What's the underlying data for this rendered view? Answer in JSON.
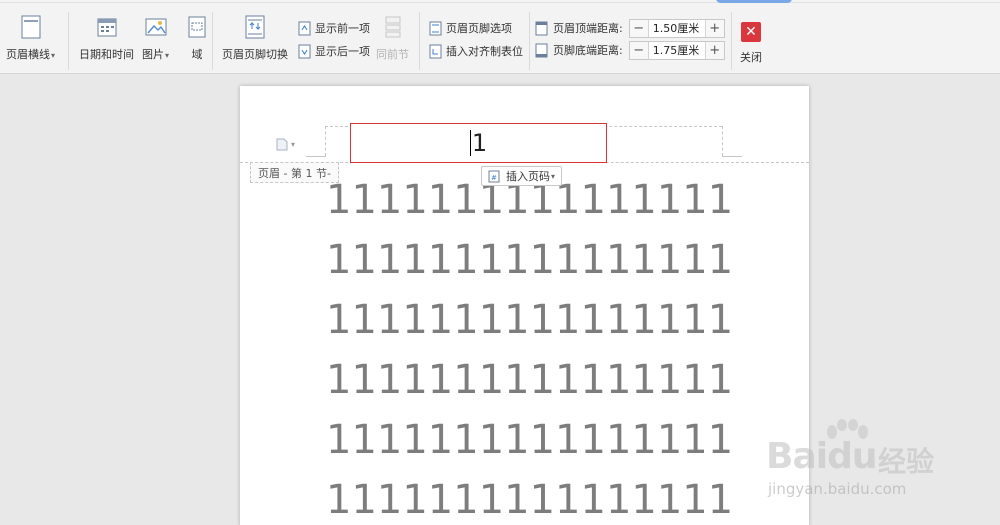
{
  "ribbon": {
    "header_line": {
      "label": "页眉横线"
    },
    "datetime": {
      "label": "日期和时间"
    },
    "picture": {
      "label": "图片"
    },
    "field": {
      "label": "域"
    },
    "switch": {
      "label": "页眉页脚切换"
    },
    "show_prev": {
      "label": "显示前一项"
    },
    "show_next": {
      "label": "显示后一项"
    },
    "same_as_prev": {
      "label": "同前节"
    },
    "options": {
      "label": "页眉页脚选项"
    },
    "insert_align_tab": {
      "label": "插入对齐制表位"
    },
    "header_top": {
      "label": "页眉顶端距离:",
      "value": "1.50厘米"
    },
    "footer_bottom": {
      "label": "页脚底端距离:",
      "value": "1.75厘米"
    },
    "close": {
      "label": "关闭"
    },
    "minus": "−",
    "plus": "+"
  },
  "document": {
    "header_text": "1",
    "section_label": "页眉 - 第 1 节-",
    "insert_page_number": "插入页码",
    "body_lines": [
      "1111111111111111",
      "1111111111111111",
      "1111111111111111",
      "1111111111111111",
      "1111111111111111",
      "1111111111111111"
    ]
  },
  "watermark": {
    "brand": "Bai",
    "brand2": "du",
    "cn": "经验",
    "url": "jingyan.baidu.com"
  },
  "colors": {
    "close_red": "#d9363e",
    "header_box_border": "#dd3333",
    "body_text": "#7d7d7d"
  }
}
